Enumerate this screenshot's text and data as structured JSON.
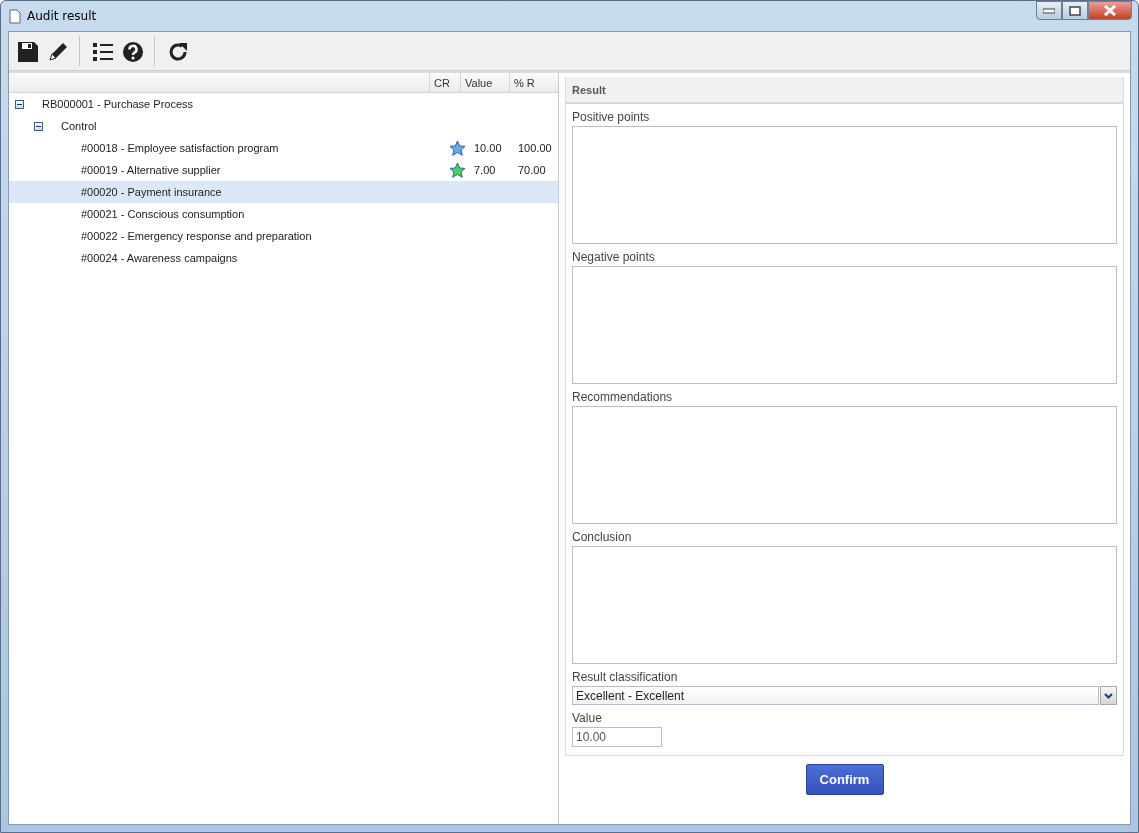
{
  "window": {
    "title": "Audit result"
  },
  "toolbar": [
    {
      "kind": "save"
    },
    {
      "kind": "edit"
    },
    {
      "kind": "separator"
    },
    {
      "kind": "list"
    },
    {
      "kind": "help"
    },
    {
      "kind": "separator"
    },
    {
      "kind": "refresh"
    }
  ],
  "tree": {
    "columns": [
      "CR",
      "Value",
      "% R"
    ],
    "items": [
      {
        "label": "RB000001 - Purchase Process",
        "expanded": true,
        "selected": false,
        "children": [
          {
            "label": "Control",
            "expanded": true,
            "selected": false,
            "children": [
              {
                "label": "#00018 - Employee satisfaction program",
                "selected": false,
                "cr": {
                  "color": "#6aaaf0"
                },
                "value": "10.00",
                "percent": "100.00"
              },
              {
                "label": "#00019 - Alternative supplier",
                "selected": false,
                "cr": {
                  "color": "#4fd24f"
                },
                "value": "7.00",
                "percent": "70.00"
              },
              {
                "label": "#00020 - Payment insurance",
                "selected": true
              },
              {
                "label": "#00021 - Conscious consumption",
                "selected": false
              },
              {
                "label": "#00022 - Emergency response and preparation",
                "selected": false
              },
              {
                "label": "#00024 - Awareness campaigns",
                "selected": false
              }
            ]
          }
        ]
      }
    ]
  },
  "result": {
    "title": "Result",
    "text_areas": [
      {
        "label": "Positive points"
      },
      {
        "label": "Negative points"
      },
      {
        "label": "Recommendations"
      },
      {
        "label": "Conclusion"
      }
    ],
    "classification": {
      "label": "Result classification",
      "value": "Excellent - Excellent"
    },
    "value": {
      "label": "Value",
      "value": "10.00"
    }
  },
  "buttons": [
    "Confirm"
  ]
}
